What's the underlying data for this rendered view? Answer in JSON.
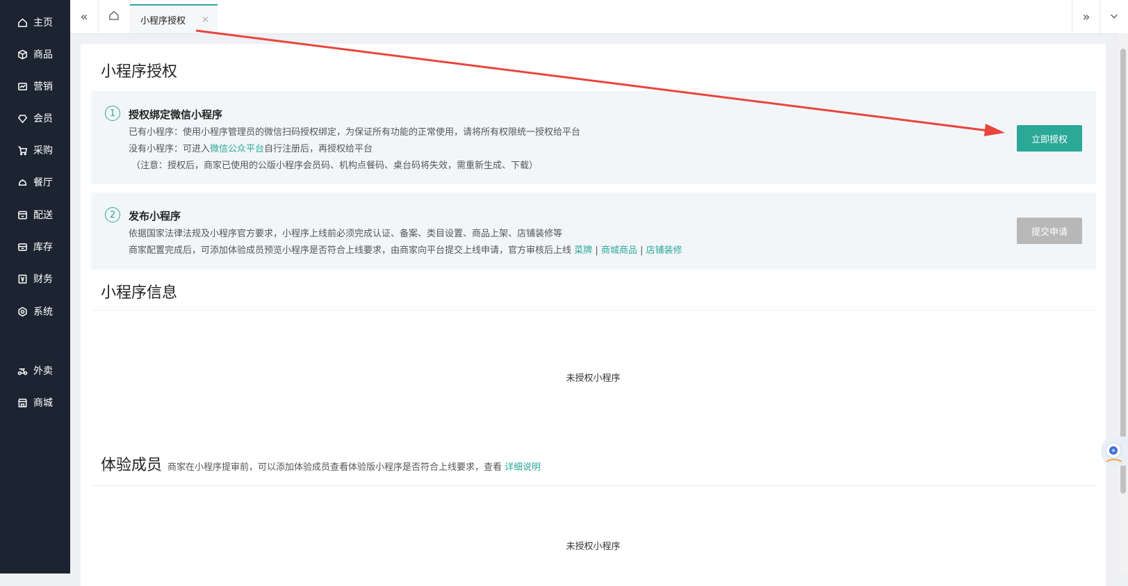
{
  "sidebar": {
    "items": [
      {
        "label": "主页",
        "icon": "home-icon"
      },
      {
        "label": "商品",
        "icon": "box-icon"
      },
      {
        "label": "营销",
        "icon": "chart-icon"
      },
      {
        "label": "会员",
        "icon": "diamond-icon"
      },
      {
        "label": "采购",
        "icon": "cart-icon"
      },
      {
        "label": "餐厅",
        "icon": "bell-icon"
      },
      {
        "label": "配送",
        "icon": "delivery-icon"
      },
      {
        "label": "库存",
        "icon": "inventory-icon"
      },
      {
        "label": "财务",
        "icon": "yen-icon"
      },
      {
        "label": "系统",
        "icon": "settings-icon"
      },
      {
        "label": "外卖",
        "icon": "scooter-icon"
      },
      {
        "label": "商城",
        "icon": "shop-icon"
      }
    ]
  },
  "topbar": {
    "collapse_icon": "«",
    "home_icon": "home-icon",
    "active_tab": "小程序授权",
    "tab_close": "×",
    "expand_icon": "»",
    "dropdown_icon": "chevron-down-icon"
  },
  "page": {
    "title": "小程序授权",
    "step1": {
      "num": "1",
      "title": "授权绑定微信小程序",
      "line1": "已有小程序：使用小程序管理员的微信扫码授权绑定，为保证所有功能的正常使用，请将所有权限统一授权给平台",
      "line2_pre": "没有小程序：可进入",
      "line2_link": "微信公众平台",
      "line2_post": "自行注册后，再授权给平台",
      "line3": "（注意：授权后，商家已使用的公版小程序会员码、机构点餐码、桌台码将失效，需重新生成、下载）",
      "button": "立即授权",
      "button_color": "#2aa898"
    },
    "step2": {
      "num": "2",
      "title": "发布小程序",
      "line1": "依据国家法律法规及小程序官方要求，小程序上线前必须完成认证、备案、类目设置、商品上架、店铺装修等",
      "line2_pre": "商家配置完成后，可添加体验成员预览小程序是否符合上线要求，由商家向平台提交上线申请，官方审核后上线",
      "link1": "菜牌",
      "sep": "|",
      "link2": "商城商品",
      "link3": "店铺装修",
      "button": "提交申请",
      "button_color": "#b8b8b8"
    },
    "info_title": "小程序信息",
    "info_empty": "未授权小程序",
    "members_title": "体验成员",
    "members_desc": "商家在小程序提审前，可以添加体验成员查看体验版小程序是否符合上线要求，查看",
    "members_link": "详细说明",
    "members_empty": "未授权小程序"
  },
  "annotation_color": "#e8453c"
}
